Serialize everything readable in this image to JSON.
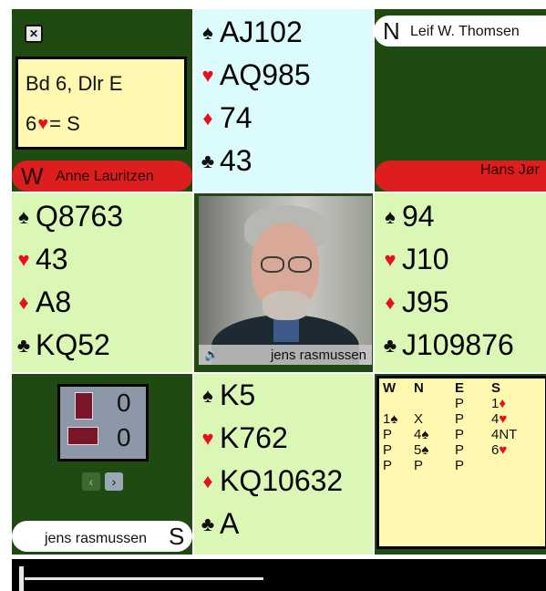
{
  "north_player": {
    "dir": "N",
    "name": "Leif W. Thomsen"
  },
  "west_player": {
    "dir": "W",
    "name": "Anne Lauritzen"
  },
  "east_player": {
    "dir": "E",
    "name": "Hans Jør"
  },
  "south_player": {
    "dir": "S",
    "name": "jens rasmussen"
  },
  "board_info": {
    "line1": "Bd 6, Dlr E",
    "contract_level": "6",
    "contract_suffix": "= S"
  },
  "hands": {
    "north": {
      "spades": "AJ102",
      "hearts": "AQ985",
      "diamonds": "74",
      "clubs": "43"
    },
    "west": {
      "spades": "Q8763",
      "hearts": "43",
      "diamonds": "A8",
      "clubs": "KQ52"
    },
    "east": {
      "spades": "94",
      "hearts": "J10",
      "diamonds": "J95",
      "clubs": "J109876"
    },
    "south": {
      "spades": "K5",
      "hearts": "K762",
      "diamonds": "KQ10632",
      "clubs": "A"
    }
  },
  "suit_icons": {
    "spades": "♠",
    "hearts": "♥",
    "diamonds": "♦",
    "clubs": "♣"
  },
  "video": {
    "caption": "jens rasmussen",
    "speaker_icon": "🔈"
  },
  "tricks": {
    "ns_won": "0",
    "ew_won": "0"
  },
  "nav": {
    "prev": "‹",
    "next": "›"
  },
  "bidding": {
    "headers": [
      "W",
      "N",
      "E",
      "S"
    ],
    "rows": [
      [
        "",
        "",
        "P",
        "1♦"
      ],
      [
        "1♠",
        "X",
        "P",
        "4♥"
      ],
      [
        "P",
        "4♠",
        "P",
        "4NT"
      ],
      [
        "P",
        "5♠",
        "P",
        "6♥"
      ],
      [
        "P",
        "P",
        "P",
        ""
      ]
    ]
  },
  "colors": {
    "felt": "#1f4a12",
    "hand_bg": "#daf7b5",
    "north_bg": "#dcfbfd",
    "info_bg": "#fff8b0",
    "red_suit": "#e8101c",
    "pill_red": "#dc1e1e"
  }
}
